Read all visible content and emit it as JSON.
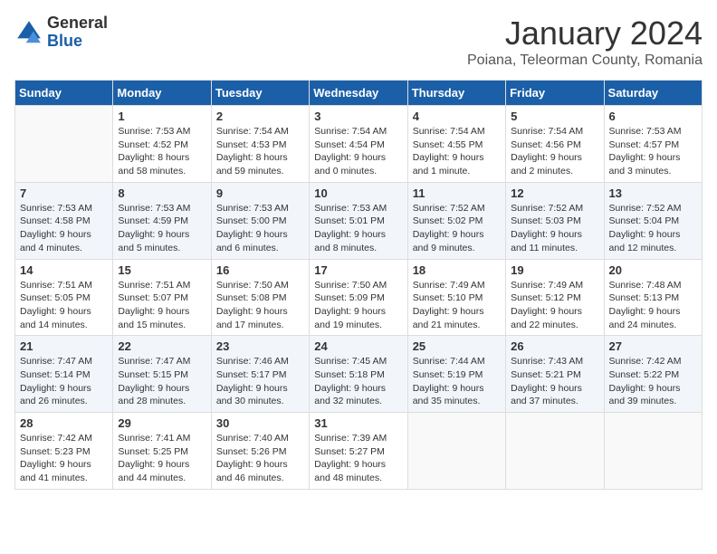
{
  "logo": {
    "general": "General",
    "blue": "Blue"
  },
  "title": "January 2024",
  "subtitle": "Poiana, Teleorman County, Romania",
  "days_header": [
    "Sunday",
    "Monday",
    "Tuesday",
    "Wednesday",
    "Thursday",
    "Friday",
    "Saturday"
  ],
  "weeks": [
    [
      {
        "day": "",
        "info": ""
      },
      {
        "day": "1",
        "info": "Sunrise: 7:53 AM\nSunset: 4:52 PM\nDaylight: 8 hours\nand 58 minutes."
      },
      {
        "day": "2",
        "info": "Sunrise: 7:54 AM\nSunset: 4:53 PM\nDaylight: 8 hours\nand 59 minutes."
      },
      {
        "day": "3",
        "info": "Sunrise: 7:54 AM\nSunset: 4:54 PM\nDaylight: 9 hours\nand 0 minutes."
      },
      {
        "day": "4",
        "info": "Sunrise: 7:54 AM\nSunset: 4:55 PM\nDaylight: 9 hours\nand 1 minute."
      },
      {
        "day": "5",
        "info": "Sunrise: 7:54 AM\nSunset: 4:56 PM\nDaylight: 9 hours\nand 2 minutes."
      },
      {
        "day": "6",
        "info": "Sunrise: 7:53 AM\nSunset: 4:57 PM\nDaylight: 9 hours\nand 3 minutes."
      }
    ],
    [
      {
        "day": "7",
        "info": "Sunrise: 7:53 AM\nSunset: 4:58 PM\nDaylight: 9 hours\nand 4 minutes."
      },
      {
        "day": "8",
        "info": "Sunrise: 7:53 AM\nSunset: 4:59 PM\nDaylight: 9 hours\nand 5 minutes."
      },
      {
        "day": "9",
        "info": "Sunrise: 7:53 AM\nSunset: 5:00 PM\nDaylight: 9 hours\nand 6 minutes."
      },
      {
        "day": "10",
        "info": "Sunrise: 7:53 AM\nSunset: 5:01 PM\nDaylight: 9 hours\nand 8 minutes."
      },
      {
        "day": "11",
        "info": "Sunrise: 7:52 AM\nSunset: 5:02 PM\nDaylight: 9 hours\nand 9 minutes."
      },
      {
        "day": "12",
        "info": "Sunrise: 7:52 AM\nSunset: 5:03 PM\nDaylight: 9 hours\nand 11 minutes."
      },
      {
        "day": "13",
        "info": "Sunrise: 7:52 AM\nSunset: 5:04 PM\nDaylight: 9 hours\nand 12 minutes."
      }
    ],
    [
      {
        "day": "14",
        "info": "Sunrise: 7:51 AM\nSunset: 5:05 PM\nDaylight: 9 hours\nand 14 minutes."
      },
      {
        "day": "15",
        "info": "Sunrise: 7:51 AM\nSunset: 5:07 PM\nDaylight: 9 hours\nand 15 minutes."
      },
      {
        "day": "16",
        "info": "Sunrise: 7:50 AM\nSunset: 5:08 PM\nDaylight: 9 hours\nand 17 minutes."
      },
      {
        "day": "17",
        "info": "Sunrise: 7:50 AM\nSunset: 5:09 PM\nDaylight: 9 hours\nand 19 minutes."
      },
      {
        "day": "18",
        "info": "Sunrise: 7:49 AM\nSunset: 5:10 PM\nDaylight: 9 hours\nand 21 minutes."
      },
      {
        "day": "19",
        "info": "Sunrise: 7:49 AM\nSunset: 5:12 PM\nDaylight: 9 hours\nand 22 minutes."
      },
      {
        "day": "20",
        "info": "Sunrise: 7:48 AM\nSunset: 5:13 PM\nDaylight: 9 hours\nand 24 minutes."
      }
    ],
    [
      {
        "day": "21",
        "info": "Sunrise: 7:47 AM\nSunset: 5:14 PM\nDaylight: 9 hours\nand 26 minutes."
      },
      {
        "day": "22",
        "info": "Sunrise: 7:47 AM\nSunset: 5:15 PM\nDaylight: 9 hours\nand 28 minutes."
      },
      {
        "day": "23",
        "info": "Sunrise: 7:46 AM\nSunset: 5:17 PM\nDaylight: 9 hours\nand 30 minutes."
      },
      {
        "day": "24",
        "info": "Sunrise: 7:45 AM\nSunset: 5:18 PM\nDaylight: 9 hours\nand 32 minutes."
      },
      {
        "day": "25",
        "info": "Sunrise: 7:44 AM\nSunset: 5:19 PM\nDaylight: 9 hours\nand 35 minutes."
      },
      {
        "day": "26",
        "info": "Sunrise: 7:43 AM\nSunset: 5:21 PM\nDaylight: 9 hours\nand 37 minutes."
      },
      {
        "day": "27",
        "info": "Sunrise: 7:42 AM\nSunset: 5:22 PM\nDaylight: 9 hours\nand 39 minutes."
      }
    ],
    [
      {
        "day": "28",
        "info": "Sunrise: 7:42 AM\nSunset: 5:23 PM\nDaylight: 9 hours\nand 41 minutes."
      },
      {
        "day": "29",
        "info": "Sunrise: 7:41 AM\nSunset: 5:25 PM\nDaylight: 9 hours\nand 44 minutes."
      },
      {
        "day": "30",
        "info": "Sunrise: 7:40 AM\nSunset: 5:26 PM\nDaylight: 9 hours\nand 46 minutes."
      },
      {
        "day": "31",
        "info": "Sunrise: 7:39 AM\nSunset: 5:27 PM\nDaylight: 9 hours\nand 48 minutes."
      },
      {
        "day": "",
        "info": ""
      },
      {
        "day": "",
        "info": ""
      },
      {
        "day": "",
        "info": ""
      }
    ]
  ]
}
